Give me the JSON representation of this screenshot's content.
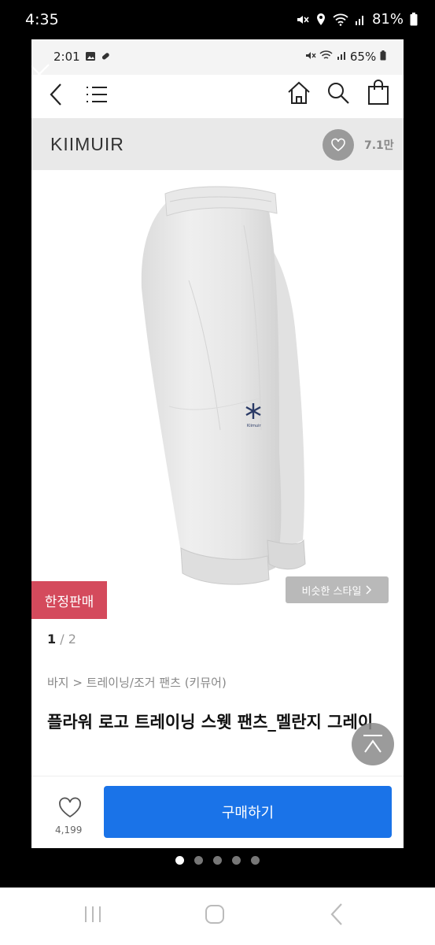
{
  "outer_status": {
    "time": "4:35",
    "battery": "81%"
  },
  "inner_status": {
    "time": "2:01",
    "battery": "65%"
  },
  "brand": {
    "name": "KIIMUIR",
    "like_count": "7.1만"
  },
  "product": {
    "logo_text": "Kiimuir",
    "badge": "한정판매",
    "similar_style": "비슷한 스타일",
    "pager_current": "1",
    "pager_sep": " / ",
    "pager_total": "2",
    "breadcrumb": "바지 > 트레이닝/조거 팬츠 (키뮤어)",
    "title": "플라워 로고 트레이닝 스웻 팬츠_멜란지 그레이"
  },
  "bottom": {
    "likes": "4,199",
    "buy": "구매하기"
  },
  "icons": [
    "close-icon",
    "back-icon",
    "menu-icon",
    "home-icon",
    "search-icon",
    "bag-icon",
    "heart-icon",
    "scroll-top-icon"
  ]
}
